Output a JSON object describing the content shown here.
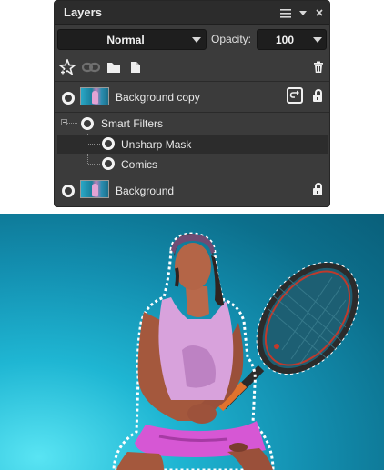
{
  "panel": {
    "title": "Layers",
    "blend_mode": "Normal",
    "opacity_label": "Opacity:",
    "opacity_value": "100"
  },
  "layers": [
    {
      "name": "Background copy",
      "locked": true,
      "has_smart_filters": true
    },
    {
      "name": "Smart Filters"
    },
    {
      "name": "Unsharp Mask",
      "selected": true
    },
    {
      "name": "Comics"
    },
    {
      "name": "Background",
      "locked": true
    }
  ],
  "toolbar": {
    "icons": [
      "new-layer-star-icon",
      "link-icon",
      "folder-icon",
      "new-document-icon",
      "trash-icon"
    ]
  },
  "colors": {
    "panel_bg": "#3b3b3b",
    "title_bg": "#2c2c2c",
    "field_bg": "#1e1e1e",
    "photo_sky": "#138fb0"
  }
}
